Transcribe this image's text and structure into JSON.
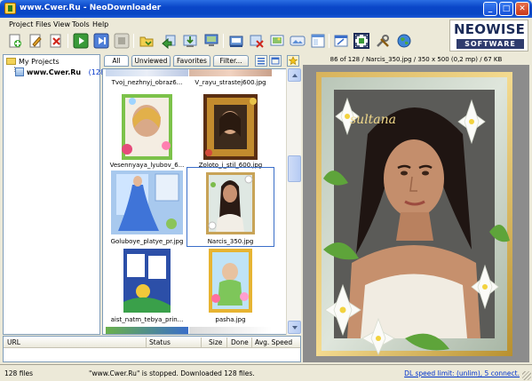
{
  "window": {
    "title": "www.Cwer.Ru - NeoDownloader",
    "controls": [
      "minimize",
      "maximize",
      "close"
    ]
  },
  "menu": [
    "Project",
    "Files",
    "View",
    "Tools",
    "Help"
  ],
  "toolbar": {
    "icons": [
      "new-project-icon",
      "edit-project-icon",
      "delete-project-icon",
      "start-icon",
      "start-all-icon",
      "stop-icon",
      "open-folder-icon",
      "import-icon",
      "download-icon",
      "screen-icon",
      "save-icon",
      "remove-icon",
      "preview-icon",
      "gallery-icon",
      "settings-icon",
      "fullscreen-icon",
      "tools-icon",
      "globe-icon"
    ]
  },
  "logo": {
    "line1": "NEOWISE",
    "line2": "SOFTWARE"
  },
  "tree": {
    "root": "My Projects",
    "project": "www.Cwer.Ru",
    "count": "(128)"
  },
  "filters": {
    "tabs": [
      "All",
      "Unviewed",
      "Favorites",
      "Filter..."
    ],
    "active": "All"
  },
  "thumbnails": [
    {
      "caption": "Tvoj_nezhnyj_obraz6..."
    },
    {
      "caption": "V_rayu_strastej600.jpg"
    },
    {
      "caption": "Vesennyaya_lyubov_6..."
    },
    {
      "caption": "Zoloto_i_stil_600.jpg"
    },
    {
      "caption": "Goluboye_platye_pr.jpg"
    },
    {
      "caption": "Narcis_350.jpg"
    },
    {
      "caption": "aist_natm_tebya_prin..."
    },
    {
      "caption": "pasha.jpg"
    }
  ],
  "selected_thumbnail": "Narcis_350.jpg",
  "preview": {
    "header": "86 of 128 / Narcis_350.jpg / 350 x 500 (0,2 mp) / 67 KB",
    "overlay_text": "sultana"
  },
  "downloads": {
    "columns": [
      "URL",
      "Status",
      "Size",
      "Done",
      "Avg. Speed"
    ]
  },
  "status": {
    "files": "128 files",
    "message": "\"www.Cwer.Ru\" is stopped. Downloaded 128 files.",
    "speed_link": "DL speed limit: (unlim), 5 connect."
  }
}
